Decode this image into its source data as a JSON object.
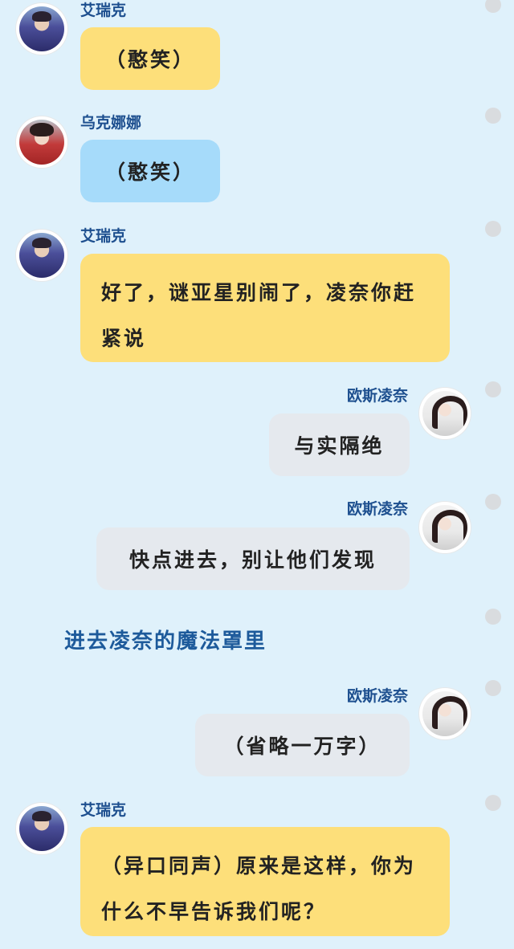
{
  "chat": {
    "messages": [
      {
        "speaker": "艾瑞克",
        "text": "（憨笑）",
        "side": "left",
        "bubble_color": "#fddf7a",
        "avatar_icon": "boy-uniform-avatar"
      },
      {
        "speaker": "乌克娜娜",
        "text": "（憨笑）",
        "side": "left",
        "bubble_color": "#a6dbfa",
        "avatar_icon": "girl-red-jacket-avatar"
      },
      {
        "speaker": "艾瑞克",
        "text": "好了，谜亚星别闹了，凌奈你赶紧说",
        "side": "left",
        "bubble_color": "#fddf7a",
        "avatar_icon": "boy-uniform-avatar"
      },
      {
        "speaker": "欧斯凌奈",
        "text": "与实隔绝",
        "side": "right",
        "bubble_color": "#e5e9ee",
        "avatar_icon": "girl-dark-hair-avatar"
      },
      {
        "speaker": "欧斯凌奈",
        "text": "快点进去，别让他们发现",
        "side": "right",
        "bubble_color": "#e5e9ee",
        "avatar_icon": "girl-dark-hair-avatar"
      },
      {
        "narration": "进去凌奈的魔法罩里"
      },
      {
        "speaker": "欧斯凌奈",
        "text": "（省略一万字）",
        "side": "right",
        "bubble_color": "#e5e9ee",
        "avatar_icon": "girl-dark-hair-avatar"
      },
      {
        "speaker": "艾瑞克",
        "text": "（异口同声）原来是这样，你为什么不早告诉我们呢？",
        "side": "left",
        "bubble_color": "#fddf7a",
        "avatar_icon": "boy-uniform-avatar"
      }
    ]
  },
  "theme": {
    "background": "#dff1fb",
    "name_color": "#1d4f8f",
    "narration_color": "#1d5a9b",
    "dot_color": "#d9dcdf"
  }
}
